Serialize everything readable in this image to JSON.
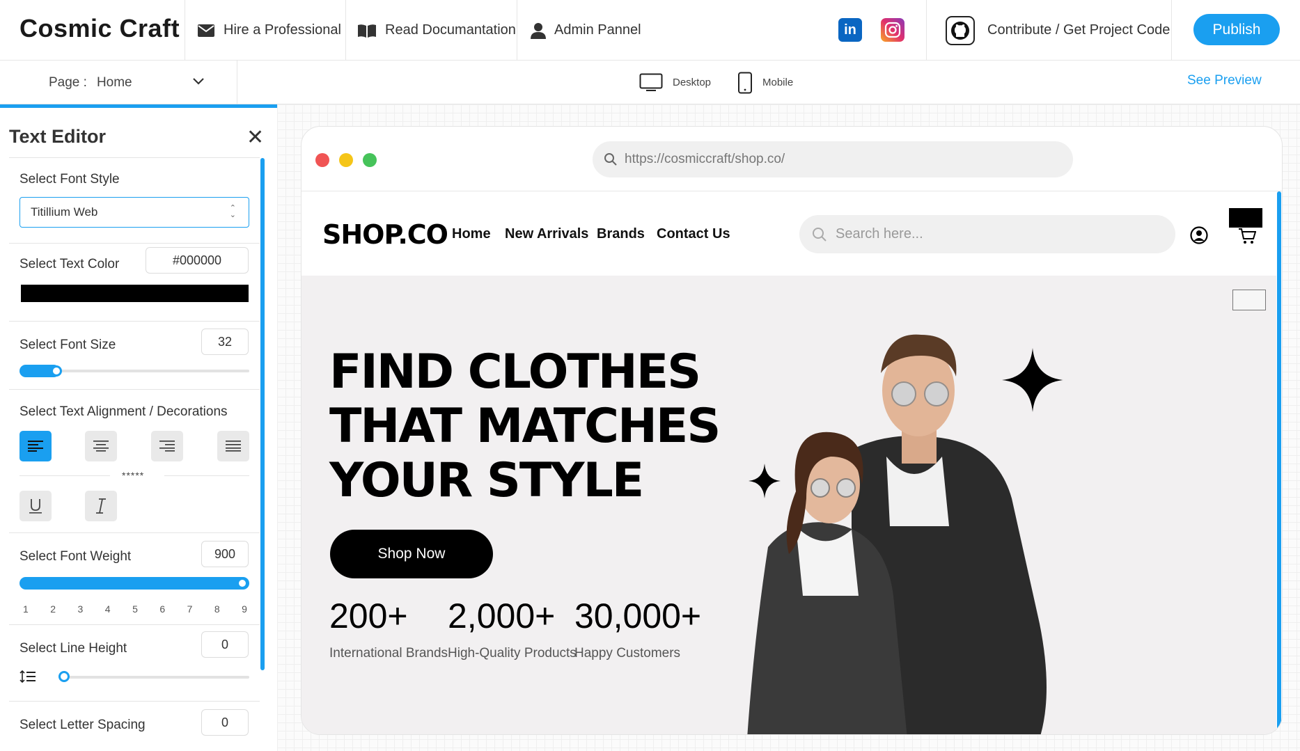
{
  "header": {
    "brand": "Cosmic Craft",
    "links": [
      {
        "label": "Hire a Professional",
        "icon": "mail-icon"
      },
      {
        "label": "Read Documantation",
        "icon": "book-icon"
      },
      {
        "label": "Admin Pannel",
        "icon": "user-icon"
      }
    ],
    "social": [
      {
        "label": "in",
        "icon": "linkedin-icon",
        "color": "#0a66c2"
      },
      {
        "icon": "instagram-icon",
        "color": "#e1306c"
      }
    ],
    "contribute_label": "Contribute / Get Project Code",
    "publish_label": "Publish"
  },
  "toolbar": {
    "page_label": "Page :",
    "page_value": "Home",
    "devices": [
      {
        "label": "Desktop",
        "icon": "desktop-icon"
      },
      {
        "label": "Mobile",
        "icon": "mobile-icon"
      }
    ],
    "see_preview": "See Preview"
  },
  "editor": {
    "title": "Text Editor",
    "font_style_label": "Select Font Style",
    "font_style_value": "Titillium Web",
    "text_color_label": "Select Text Color",
    "text_color_value": "#000000",
    "font_size_label": "Select Font Size",
    "font_size_value": "32",
    "font_size_level": 0.14,
    "alignment_label": "Select Text Alignment / Decorations",
    "alignment_separator": "*****",
    "alignment_active": "left",
    "font_weight_label": "Select Font Weight",
    "font_weight_value": "900",
    "font_weight_ticks": [
      "1",
      "2",
      "3",
      "4",
      "5",
      "6",
      "7",
      "8",
      "9"
    ],
    "line_height_label": "Select Line Height",
    "line_height_value": "0",
    "letter_spacing_label": "Select Letter Spacing",
    "letter_spacing_value": "0"
  },
  "preview": {
    "url": "https://cosmiccraft/shop.co/",
    "logo": "SHOP.CO",
    "menu": [
      "Home",
      "New Arrivals",
      "Brands",
      "Contact Us"
    ],
    "search_placeholder": "Search here...",
    "headline": [
      "FIND CLOTHES",
      "THAT MATCHES",
      "YOUR STYLE"
    ],
    "cta": "Shop Now",
    "stats": [
      {
        "value": "200+",
        "label": "International Brands"
      },
      {
        "value": "2,000+",
        "label": "High-Quality Products"
      },
      {
        "value": "30,000+",
        "label": "Happy Customers"
      }
    ]
  }
}
